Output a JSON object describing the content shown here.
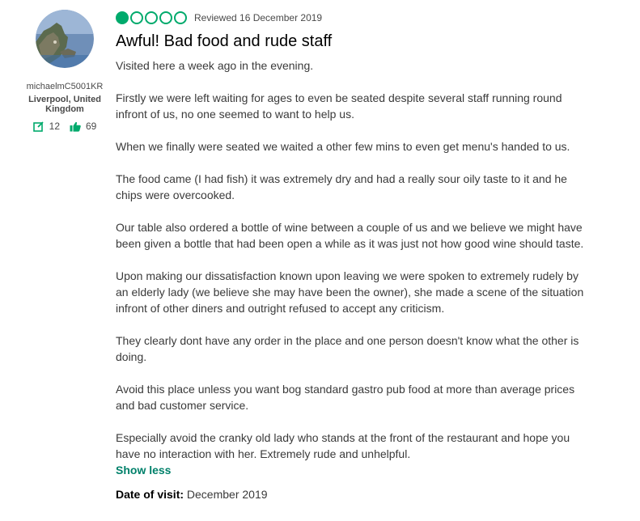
{
  "member": {
    "username": "michaelmC5001KR",
    "location": "Liverpool, United Kingdom",
    "contributions": "12",
    "helpful_votes": "69"
  },
  "review": {
    "rating": 1,
    "rating_max": 5,
    "reviewed_date": "Reviewed 16 December 2019",
    "title": "Awful! Bad food and rude staff",
    "paragraphs": [
      "Visited here a week ago in the evening.",
      "Firstly we were left waiting for ages to even be seated despite several staff running round infront of us, no one seemed to want to help us.",
      "When we finally were seated we waited a other few mins to even get menu's handed to us.",
      "The food came (I had fish) it was extremely dry and had a really sour oily taste to it and he chips were overcooked.",
      "Our table also ordered a bottle of wine between a couple of us and we believe we might have been given a bottle that had been open a while as it was just not how good wine should taste.",
      "Upon making our dissatisfaction known upon leaving we were spoken to extremely rudely by an elderly lady (we believe she may have been the owner), she made a scene of the situation infront of other diners and outright refused to accept any criticism.",
      "They clearly dont have any order in the place and one person doesn't know what the other is doing.",
      "Avoid this place unless you want bog standard gastro pub food at more than average prices and bad customer service.",
      "Especially avoid the cranky old lady who stands at the front of the restaurant and hope you have no interaction with her. Extremely rude and unhelpful."
    ],
    "show_less_label": "Show less",
    "date_of_visit_label": "Date of visit:",
    "date_of_visit": "December 2019"
  },
  "colors": {
    "accent": "#00aa6c",
    "link": "#00806a"
  }
}
